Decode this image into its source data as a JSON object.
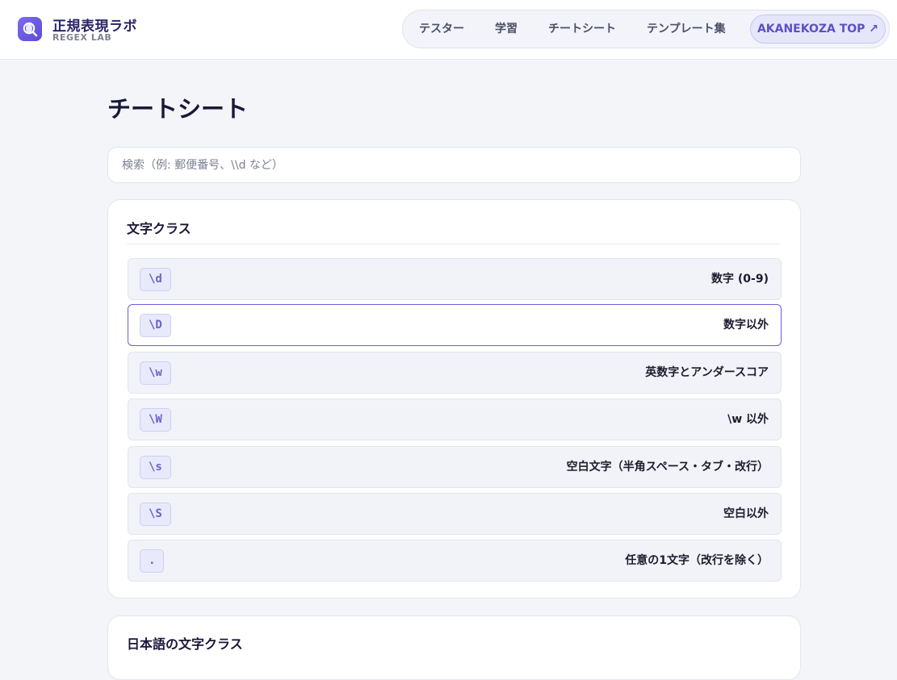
{
  "header": {
    "brand_title": "正規表現ラボ",
    "brand_sub": "REGEX LAB",
    "logo_icon": "magnifier-regex-icon"
  },
  "nav": {
    "items": [
      "テスター",
      "学習",
      "チートシート",
      "テンプレート集"
    ],
    "top_link": "AKANEKOZA TOP ↗"
  },
  "page": {
    "title": "チートシート"
  },
  "search": {
    "placeholder": "検索（例: 郵便番号、\\\\d など）",
    "value": ""
  },
  "sections": [
    {
      "title": "文字クラス",
      "rows": [
        {
          "token": "\\d",
          "description": "数字 (0-9)"
        },
        {
          "token": "\\D",
          "description": "数字以外"
        },
        {
          "token": "\\w",
          "description": "英数字とアンダースコア"
        },
        {
          "token": "\\W",
          "description": "\\w 以外"
        },
        {
          "token": "\\s",
          "description": "空白文字（半角スペース・タブ・改行）"
        },
        {
          "token": "\\S",
          "description": "空白以外"
        },
        {
          "token": ".",
          "description": "任意の1文字（改行を除く）"
        }
      ]
    },
    {
      "title": "日本語の文字クラス",
      "rows": []
    }
  ],
  "colors": {
    "accent": "#6b5fd8",
    "background": "#f3f5f9",
    "token_text": "#6a63c8"
  }
}
